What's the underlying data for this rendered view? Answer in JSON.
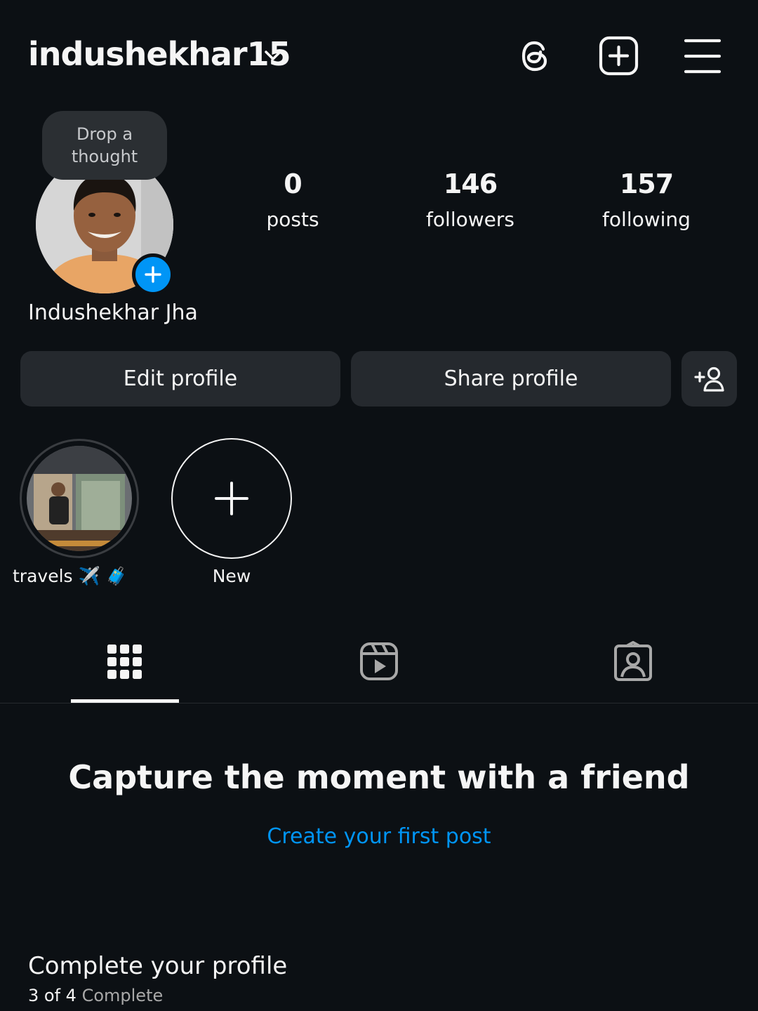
{
  "header": {
    "username": "indushekhar15"
  },
  "profile": {
    "thought_placeholder": "Drop a thought",
    "full_name": "Indushekhar Jha",
    "stats": [
      {
        "value": "0",
        "label": "posts"
      },
      {
        "value": "146",
        "label": "followers"
      },
      {
        "value": "157",
        "label": "following"
      }
    ]
  },
  "actions": {
    "edit_label": "Edit profile",
    "share_label": "Share profile"
  },
  "highlights": [
    {
      "label": "travels ✈️ 🧳"
    },
    {
      "label": "New"
    }
  ],
  "empty_state": {
    "title": "Capture the moment with a friend",
    "link": "Create your first post"
  },
  "complete_profile": {
    "title": "Complete your profile",
    "progress_count": "3 of 4",
    "progress_word": "Complete"
  },
  "colors": {
    "background": "#0c1014",
    "accent_blue": "#0095f6",
    "button_bg": "#25292e"
  }
}
